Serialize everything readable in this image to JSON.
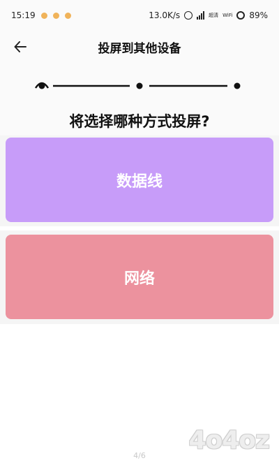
{
  "status_bar": {
    "time": "15:19",
    "speed": "13.0K/s",
    "wifi_labels": [
      "超清",
      "WiFi"
    ],
    "battery": "89%",
    "dot_color": "#f0b35a"
  },
  "header": {
    "title": "投屏到其他设备",
    "back_icon": "arrow-left-icon"
  },
  "stepper": {
    "current_step": 1,
    "total_steps": 3
  },
  "question": {
    "text": "将选择哪种方式投屏?"
  },
  "options": [
    {
      "label": "数据线",
      "color": "#c79cf9"
    },
    {
      "label": "网络",
      "color": "#ec929e"
    }
  ],
  "page_indicator": "4/6",
  "watermark": "4o4oz"
}
